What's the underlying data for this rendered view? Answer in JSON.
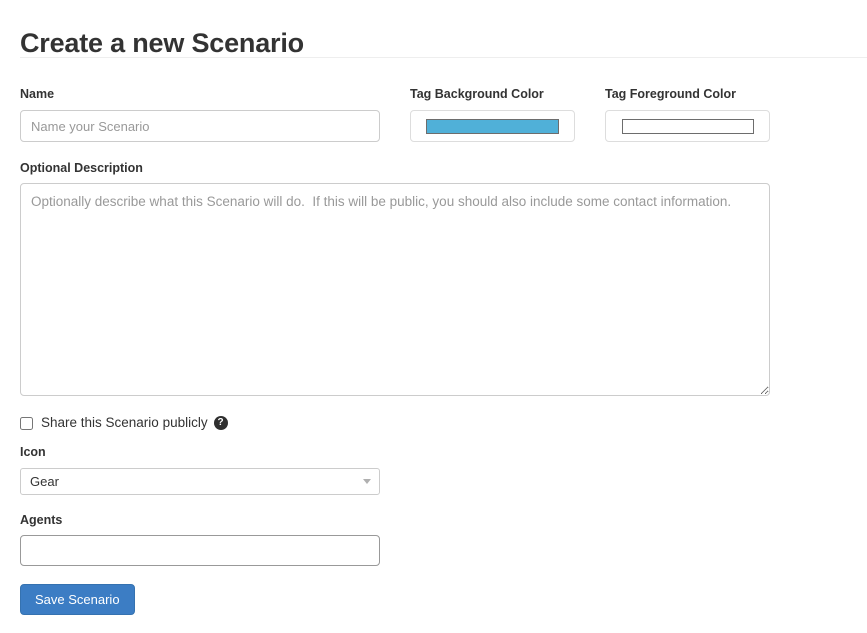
{
  "page": {
    "title": "Create a new Scenario"
  },
  "form": {
    "name": {
      "label": "Name",
      "placeholder": "Name your Scenario",
      "value": ""
    },
    "tag_background_color": {
      "label": "Tag Background Color",
      "swatch_color": "#50b0d8",
      "swatch_border_color": "#6d6d6d"
    },
    "tag_foreground_color": {
      "label": "Tag Foreground Color",
      "swatch_color": "#ffffff",
      "swatch_border_color": "#6d6d6d"
    },
    "description": {
      "label": "Optional Description",
      "placeholder": "Optionally describe what this Scenario will do.  If this will be public, you should also include some contact information.",
      "value": ""
    },
    "share_publicly": {
      "label": "Share this Scenario publicly",
      "checked": false,
      "help_icon": "question-mark-circle-icon",
      "help_glyph": "?"
    },
    "icon": {
      "label": "Icon",
      "selected": "Gear",
      "options": [
        "Gear"
      ],
      "caret_icon": "chevron-down-icon"
    },
    "agents": {
      "label": "Agents",
      "value": "",
      "placeholder": ""
    },
    "save": {
      "label": "Save Scenario",
      "color": "#3c7dc4"
    }
  }
}
